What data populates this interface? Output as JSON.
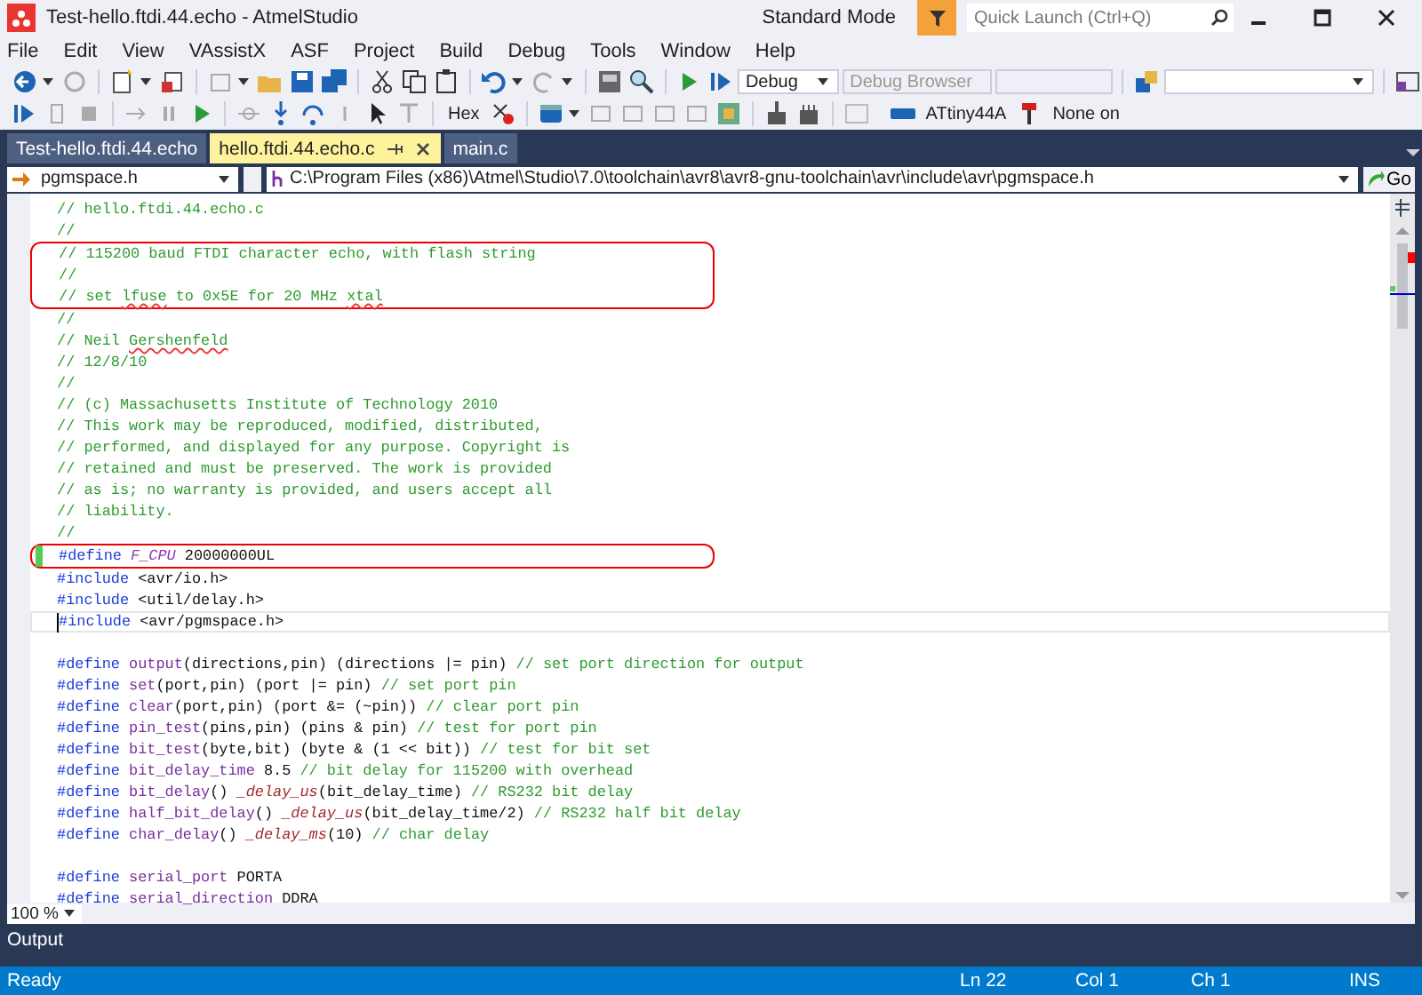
{
  "window": {
    "title": "Test-hello.ftdi.44.echo - AtmelStudio",
    "mode": "Standard Mode",
    "quick_launch": {
      "placeholder": "Quick Launch (Ctrl+Q)"
    }
  },
  "menu": [
    "File",
    "Edit",
    "View",
    "VAssistX",
    "ASF",
    "Project",
    "Build",
    "Debug",
    "Tools",
    "Window",
    "Help"
  ],
  "toolbar": {
    "configuration": "Debug",
    "debug_browser": {
      "label": "Debug Browser",
      "disabled": true
    },
    "hex": "Hex",
    "device": "ATtiny44A",
    "tool": "None on"
  },
  "tabs": [
    {
      "label": "Test-hello.ftdi.44.echo",
      "selected": false
    },
    {
      "label": "hello.ftdi.44.echo.c",
      "selected": true
    },
    {
      "label": "main.c",
      "selected": false
    }
  ],
  "navigation": {
    "scope": "pgmspace.h",
    "path": "C:\\Program Files (x86)\\Atmel\\Studio\\7.0\\toolchain\\avr8\\avr8-gnu-toolchain\\avr\\include\\avr\\pgmspace.h",
    "go": "Go"
  },
  "code": [
    {
      "tokens": [
        {
          "kind": "comment",
          "text": "// hello.ftdi.44.echo.c"
        }
      ],
      "boxed": false,
      "changed": false,
      "current": false
    },
    {
      "tokens": [
        {
          "kind": "comment",
          "text": "//"
        }
      ],
      "boxed": false,
      "changed": false,
      "current": false
    },
    {
      "tokens": [
        {
          "kind": "comment",
          "text": "// 115200 baud FTDI character echo, with flash string"
        }
      ],
      "boxed": true,
      "changed": false,
      "current": false
    },
    {
      "tokens": [
        {
          "kind": "comment",
          "text": "//"
        }
      ],
      "boxed": true,
      "changed": false,
      "current": false
    },
    {
      "tokens": [
        {
          "kind": "comment",
          "text": "// set "
        },
        {
          "kind": "misspelled",
          "text": "lfuse"
        },
        {
          "kind": "comment",
          "text": " to 0x5E for 20 MHz "
        },
        {
          "kind": "misspelled",
          "text": "xtal"
        }
      ],
      "boxed": true,
      "changed": false,
      "current": false
    },
    {
      "tokens": [
        {
          "kind": "comment",
          "text": "//"
        }
      ],
      "boxed": false,
      "changed": false,
      "current": false
    },
    {
      "tokens": [
        {
          "kind": "comment",
          "text": "// Neil "
        },
        {
          "kind": "misspelled",
          "text": "Gershenfeld"
        }
      ],
      "boxed": false,
      "changed": false,
      "current": false
    },
    {
      "tokens": [
        {
          "kind": "comment",
          "text": "// 12/8/10"
        }
      ],
      "boxed": false,
      "changed": false,
      "current": false
    },
    {
      "tokens": [
        {
          "kind": "comment",
          "text": "//"
        }
      ],
      "boxed": false,
      "changed": false,
      "current": false
    },
    {
      "tokens": [
        {
          "kind": "comment",
          "text": "// (c) Massachusetts Institute of Technology 2010"
        }
      ],
      "boxed": false,
      "changed": false,
      "current": false
    },
    {
      "tokens": [
        {
          "kind": "comment",
          "text": "// This work may be reproduced, modified, distributed,"
        }
      ],
      "boxed": false,
      "changed": false,
      "current": false
    },
    {
      "tokens": [
        {
          "kind": "comment",
          "text": "// performed, and displayed for any purpose. Copyright is"
        }
      ],
      "boxed": false,
      "changed": false,
      "current": false
    },
    {
      "tokens": [
        {
          "kind": "comment",
          "text": "// retained and must be preserved. The work is provided"
        }
      ],
      "boxed": false,
      "changed": false,
      "current": false
    },
    {
      "tokens": [
        {
          "kind": "comment",
          "text": "// as is; no warranty is provided, and users accept all"
        }
      ],
      "boxed": false,
      "changed": false,
      "current": false
    },
    {
      "tokens": [
        {
          "kind": "comment",
          "text": "// liability."
        }
      ],
      "boxed": false,
      "changed": false,
      "current": false
    },
    {
      "tokens": [
        {
          "kind": "comment",
          "text": "//"
        }
      ],
      "boxed": false,
      "changed": false,
      "current": false
    },
    {
      "tokens": [
        {
          "kind": "keyword",
          "text": "#define"
        },
        {
          "kind": "constant",
          "text": " F_CPU"
        },
        {
          "kind": "plain",
          "text": " 20000000UL"
        }
      ],
      "boxed": true,
      "changed": true,
      "current": false
    },
    {
      "tokens": [
        {
          "kind": "keyword",
          "text": "#include"
        },
        {
          "kind": "plain",
          "text": " <avr/io.h>"
        }
      ],
      "boxed": false,
      "changed": false,
      "current": false
    },
    {
      "tokens": [
        {
          "kind": "keyword",
          "text": "#include"
        },
        {
          "kind": "plain",
          "text": " <util/delay.h>"
        }
      ],
      "boxed": false,
      "changed": false,
      "current": false
    },
    {
      "tokens": [
        {
          "kind": "keyword",
          "text": "#include"
        },
        {
          "kind": "plain",
          "text": " <avr/pgmspace.h>"
        }
      ],
      "boxed": false,
      "changed": false,
      "current": true
    },
    {
      "kind": "blank"
    },
    {
      "tokens": [
        {
          "kind": "keyword",
          "text": "#define"
        },
        {
          "kind": "macro",
          "text": " output"
        },
        {
          "kind": "plain",
          "text": "(directions,pin) (directions |= pin) "
        },
        {
          "kind": "comment",
          "text": "// set port direction for output"
        }
      ],
      "boxed": false,
      "changed": false,
      "current": false
    },
    {
      "tokens": [
        {
          "kind": "keyword",
          "text": "#define"
        },
        {
          "kind": "macro",
          "text": " set"
        },
        {
          "kind": "plain",
          "text": "(port,pin) (port |= pin) "
        },
        {
          "kind": "comment",
          "text": "// set port pin"
        }
      ],
      "boxed": false,
      "changed": false,
      "current": false
    },
    {
      "tokens": [
        {
          "kind": "keyword",
          "text": "#define"
        },
        {
          "kind": "macro",
          "text": " clear"
        },
        {
          "kind": "plain",
          "text": "(port,pin) (port &= (~pin)) "
        },
        {
          "kind": "comment",
          "text": "// clear port pin"
        }
      ],
      "boxed": false,
      "changed": false,
      "current": false
    },
    {
      "tokens": [
        {
          "kind": "keyword",
          "text": "#define"
        },
        {
          "kind": "macro",
          "text": " pin_test"
        },
        {
          "kind": "plain",
          "text": "(pins,pin) (pins & pin) "
        },
        {
          "kind": "comment",
          "text": "// test for port pin"
        }
      ],
      "boxed": false,
      "changed": false,
      "current": false
    },
    {
      "tokens": [
        {
          "kind": "keyword",
          "text": "#define"
        },
        {
          "kind": "macro",
          "text": " bit_test"
        },
        {
          "kind": "plain",
          "text": "(byte,bit) (byte & (1 << bit)) "
        },
        {
          "kind": "comment",
          "text": "// test for bit set"
        }
      ],
      "boxed": false,
      "changed": false,
      "current": false
    },
    {
      "tokens": [
        {
          "kind": "keyword",
          "text": "#define"
        },
        {
          "kind": "macro",
          "text": " bit_delay_time"
        },
        {
          "kind": "plain",
          "text": " 8.5 "
        },
        {
          "kind": "comment",
          "text": "// bit delay for 115200 with overhead"
        }
      ],
      "boxed": false,
      "changed": false,
      "current": false
    },
    {
      "tokens": [
        {
          "kind": "keyword",
          "text": "#define"
        },
        {
          "kind": "macro",
          "text": " bit_delay"
        },
        {
          "kind": "plain",
          "text": "() "
        },
        {
          "kind": "function",
          "text": "_delay_us"
        },
        {
          "kind": "plain",
          "text": "(bit_delay_time) "
        },
        {
          "kind": "comment",
          "text": "// RS232 bit delay"
        }
      ],
      "boxed": false,
      "changed": false,
      "current": false
    },
    {
      "tokens": [
        {
          "kind": "keyword",
          "text": "#define"
        },
        {
          "kind": "macro",
          "text": " half_bit_delay"
        },
        {
          "kind": "plain",
          "text": "() "
        },
        {
          "kind": "function",
          "text": "_delay_us"
        },
        {
          "kind": "plain",
          "text": "(bit_delay_time/2) "
        },
        {
          "kind": "comment",
          "text": "// RS232 half bit delay"
        }
      ],
      "boxed": false,
      "changed": false,
      "current": false
    },
    {
      "tokens": [
        {
          "kind": "keyword",
          "text": "#define"
        },
        {
          "kind": "macro",
          "text": " char_delay"
        },
        {
          "kind": "plain",
          "text": "() "
        },
        {
          "kind": "function",
          "text": "_delay_ms"
        },
        {
          "kind": "plain",
          "text": "(10) "
        },
        {
          "kind": "comment",
          "text": "// char delay"
        }
      ],
      "boxed": false,
      "changed": false,
      "current": false
    },
    {
      "kind": "blank"
    },
    {
      "tokens": [
        {
          "kind": "keyword",
          "text": "#define"
        },
        {
          "kind": "macro",
          "text": " serial_port"
        },
        {
          "kind": "plain",
          "text": " PORTA"
        }
      ],
      "boxed": false,
      "changed": false,
      "current": false
    },
    {
      "tokens": [
        {
          "kind": "keyword",
          "text": "#define"
        },
        {
          "kind": "macro",
          "text": " serial_direction"
        },
        {
          "kind": "plain",
          "text": " DDRA"
        }
      ],
      "boxed": false,
      "changed": false,
      "current": false
    }
  ],
  "zoom": "100 %",
  "output_panel": {
    "title": "Output"
  },
  "status_bar": {
    "message": "Ready",
    "line": "Ln 22",
    "column": "Col 1",
    "char": "Ch 1",
    "mode": "INS"
  }
}
